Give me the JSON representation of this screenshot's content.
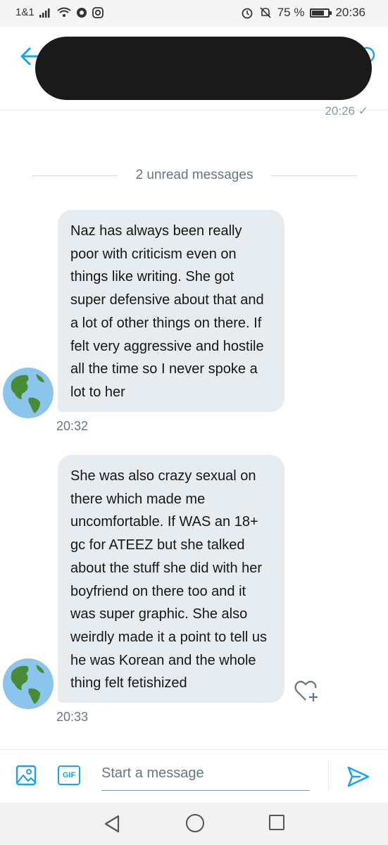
{
  "status_bar": {
    "carrier": "1&1",
    "battery_pct": "75 %",
    "battery_level": 0.75,
    "time": "20:36"
  },
  "header": {
    "back_icon": "arrow-left-icon"
  },
  "previous_message_time": "20:26",
  "unread_divider": "2 unread messages",
  "messages": [
    {
      "text": "Naz has always been really poor with criticism even on things like writing. She got super defensive about that and a lot of other things on there. If felt very aggressive and hostile all the time so I never spoke a lot to her",
      "time": "20:32"
    },
    {
      "text": "She was also crazy sexual on there which made me uncomfortable. If WAS an 18+ gc for ATEEZ but she talked about the stuff she did with her boyfriend on there too and it was super graphic. She also weirdly made it a point to tell us he was Korean and the whole thing felt fetishized",
      "time": "20:33"
    }
  ],
  "composer": {
    "gif_label": "GIF",
    "placeholder": "Start a message"
  },
  "colors": {
    "accent": "#1da1f2",
    "bubble": "#e6ecf0",
    "muted_text": "#657786"
  }
}
